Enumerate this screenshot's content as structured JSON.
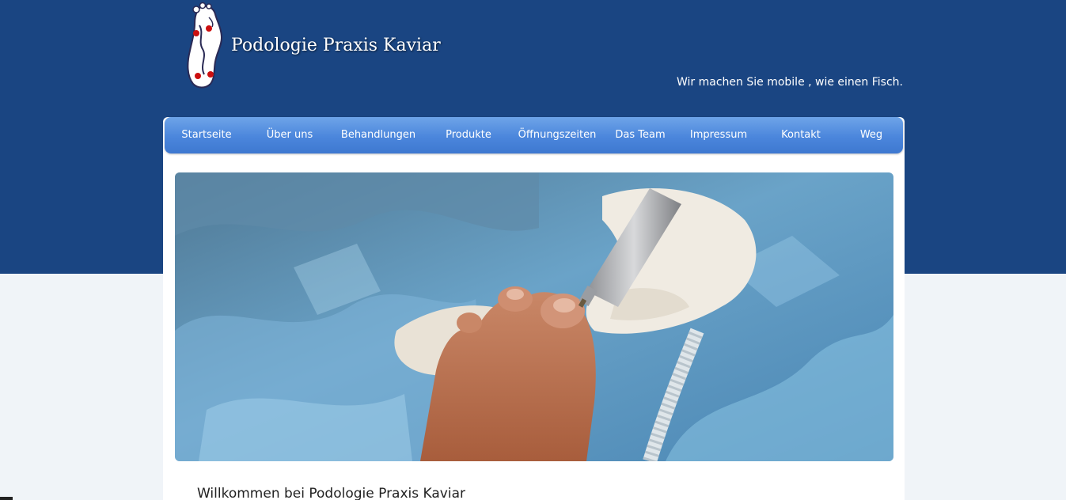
{
  "header": {
    "site_title": "Podologie Praxis Kaviar",
    "slogan": "Wir machen Sie mobile , wie einen Fisch."
  },
  "nav": {
    "items": [
      {
        "label": "Startseite"
      },
      {
        "label": "Über uns"
      },
      {
        "label": "Behandlungen"
      },
      {
        "label": "Produkte"
      },
      {
        "label": "Öffnungszeiten"
      },
      {
        "label": "Das Team"
      },
      {
        "label": "Impressum"
      },
      {
        "label": "Kontakt"
      },
      {
        "label": "Weg"
      }
    ]
  },
  "main": {
    "welcome_heading": "Willkommen bei   Podologie Praxis Kaviar"
  },
  "colors": {
    "header_blue": "#1a4582",
    "nav_blue": "#4b86dc",
    "page_background": "#f0f4f8"
  },
  "icons": {
    "logo": "foot-logo-icon"
  }
}
